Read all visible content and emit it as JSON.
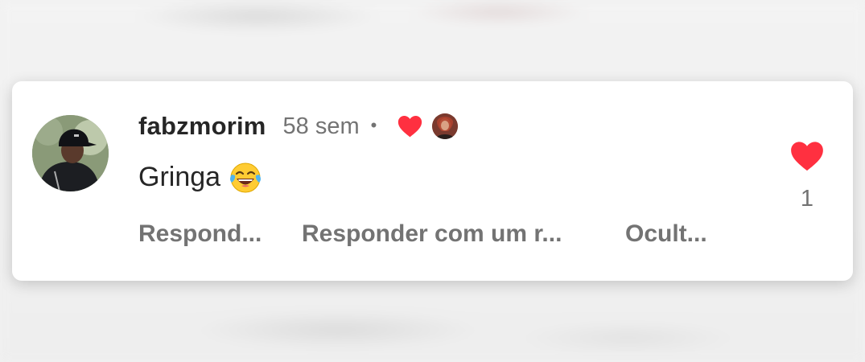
{
  "comment": {
    "username": "fabzmorim",
    "timestamp": "58 sem",
    "separator": "•",
    "text": "Gringa",
    "emoji": "face-with-tears-of-joy",
    "liked_by_creator": true
  },
  "actions": {
    "reply_label": "Respond...",
    "story_reply_label": "Responder com um r...",
    "hide_label": "Ocult..."
  },
  "like": {
    "count": "1",
    "liked": true
  },
  "colors": {
    "heart": "#ff3040",
    "text_primary": "#262626",
    "text_secondary": "#737373",
    "card": "#ffffff",
    "background": "#f1f1f1"
  },
  "icons": {
    "like": "heart-filled-icon",
    "creator_like": "heart-filled-icon",
    "emoji": "laughing-tears-emoji"
  }
}
